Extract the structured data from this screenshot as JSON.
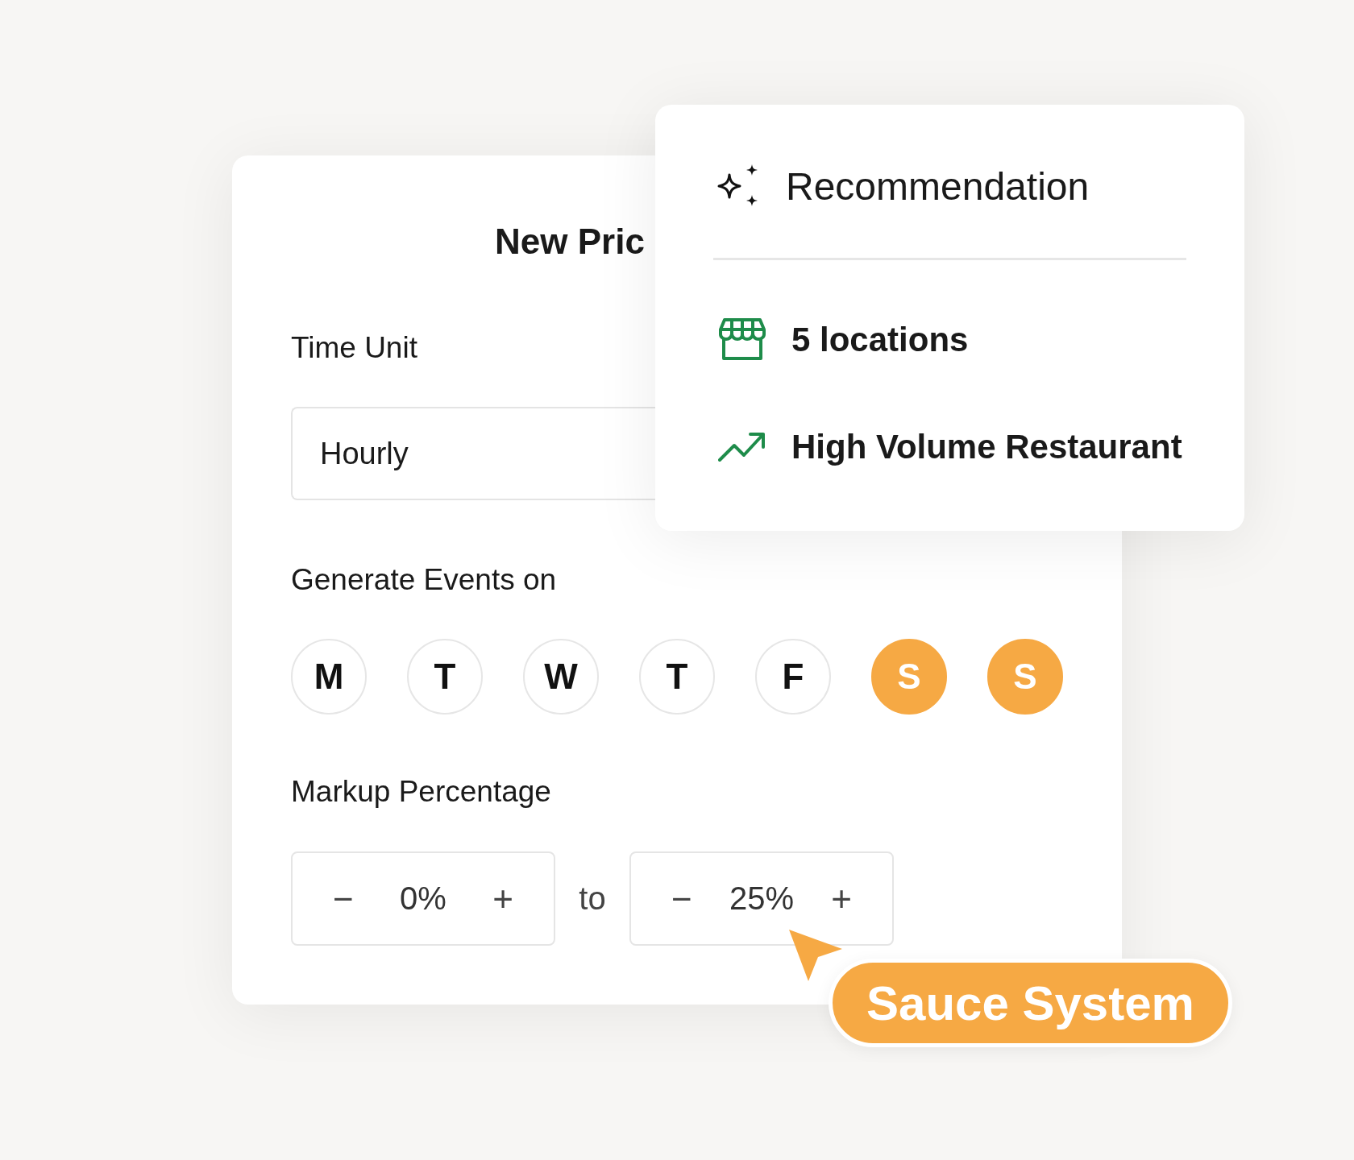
{
  "pricing_form": {
    "title": "New Pric",
    "time_unit": {
      "label": "Time Unit",
      "value": "Hourly"
    },
    "days": {
      "label": "Generate Events on",
      "items": [
        {
          "label": "M",
          "selected": false
        },
        {
          "label": "T",
          "selected": false
        },
        {
          "label": "W",
          "selected": false
        },
        {
          "label": "T",
          "selected": false
        },
        {
          "label": "F",
          "selected": false
        },
        {
          "label": "S",
          "selected": true
        },
        {
          "label": "S",
          "selected": true
        }
      ]
    },
    "markup": {
      "label": "Markup Percentage",
      "separator": "to",
      "steppers": [
        {
          "decrement": "−",
          "value": "0%",
          "increment": "+"
        },
        {
          "decrement": "−",
          "value": "25%",
          "increment": "+"
        }
      ]
    }
  },
  "recommendation": {
    "title": "Recommendation",
    "items": [
      {
        "kind": "store",
        "text": "5 locations"
      },
      {
        "kind": "trend",
        "text": "High Volume Restaurant"
      }
    ]
  },
  "cursor_label": "Sauce System"
}
